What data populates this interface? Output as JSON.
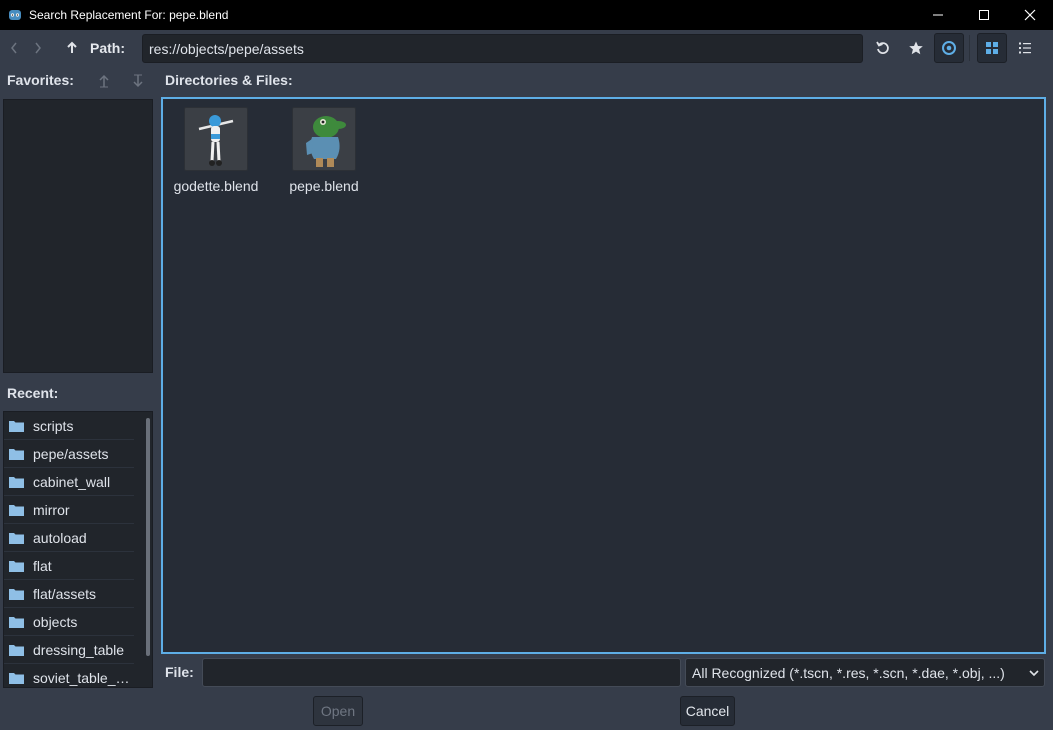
{
  "window": {
    "title": "Search Replacement For: pepe.blend"
  },
  "toolbar": {
    "path_label": "Path:",
    "path_value": "res://objects/pepe/assets"
  },
  "favorites": {
    "label": "Favorites:"
  },
  "recent": {
    "label": "Recent:",
    "items": [
      {
        "label": "scripts"
      },
      {
        "label": "pepe/assets"
      },
      {
        "label": "cabinet_wall"
      },
      {
        "label": "mirror"
      },
      {
        "label": "autoload"
      },
      {
        "label": "flat"
      },
      {
        "label": "flat/assets"
      },
      {
        "label": "objects"
      },
      {
        "label": "dressing_table"
      },
      {
        "label": "soviet_table_b..."
      }
    ]
  },
  "files": {
    "label": "Directories & Files:",
    "items": [
      {
        "name": "godette.blend"
      },
      {
        "name": "pepe.blend"
      }
    ]
  },
  "footer": {
    "file_label": "File:",
    "file_value": "",
    "filter": "All Recognized (*.tscn, *.res, *.scn, *.dae, *.obj, ...)",
    "open_label": "Open",
    "cancel_label": "Cancel"
  },
  "colors": {
    "accent": "#5eaee6",
    "background": "#363d4a",
    "panel": "#262c36",
    "titlebar": "#000000"
  }
}
